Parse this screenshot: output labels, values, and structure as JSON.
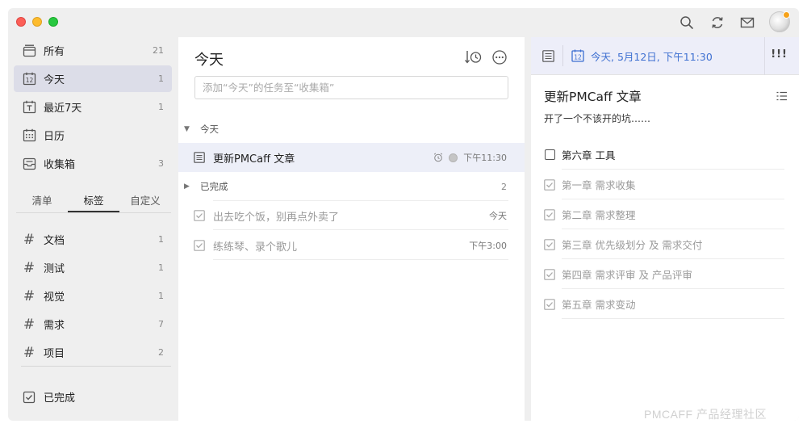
{
  "sidebar": {
    "items": [
      {
        "label": "所有",
        "count": "21",
        "icon": "inbox-tray-icon"
      },
      {
        "label": "今天",
        "count": "1",
        "icon": "calendar-day-icon",
        "icon_text": "12"
      },
      {
        "label": "最近7天",
        "count": "1",
        "icon": "calendar-week-icon"
      },
      {
        "label": "日历",
        "count": "",
        "icon": "calendar-grid-icon"
      },
      {
        "label": "收集箱",
        "count": "3",
        "icon": "inbox-icon"
      }
    ],
    "tabs": [
      "清单",
      "标签",
      "自定义"
    ],
    "tags": [
      {
        "label": "文档",
        "count": "1"
      },
      {
        "label": "测试",
        "count": "1"
      },
      {
        "label": "视觉",
        "count": "1"
      },
      {
        "label": "需求",
        "count": "7"
      },
      {
        "label": "项目",
        "count": "2"
      }
    ],
    "hash_symbol": "#",
    "completed_label": "已完成"
  },
  "list": {
    "title": "今天",
    "add_placeholder": "添加“今天”的任务至“收集箱”",
    "today_section": "今天",
    "tasks": [
      {
        "text": "更新PMCaff 文章",
        "time": "下午11:30"
      }
    ],
    "completed_section": "已完成",
    "completed_count": "2",
    "completed_tasks": [
      {
        "text": "出去吃个饭，别再点外卖了",
        "time": "今天"
      },
      {
        "text": "练练琴、录个歌儿",
        "time": "下午3:00"
      }
    ]
  },
  "detail": {
    "date_icon_text": "12",
    "date": "今天, 5月12日, 下午11:30",
    "priority": "!!!",
    "title": "更新PMCaff 文章",
    "description": "开了一个不该开的坑……",
    "subtasks": [
      {
        "text": "第六章 工具",
        "done": false
      },
      {
        "text": "第一章 需求收集",
        "done": true
      },
      {
        "text": "第二章 需求整理",
        "done": true
      },
      {
        "text": "第三章 优先级划分 及 需求交付",
        "done": true
      },
      {
        "text": "第四章 需求评审 及 产品评审",
        "done": true
      },
      {
        "text": "第五章 需求变动",
        "done": true
      }
    ]
  },
  "watermark": "PMCAFF 产品经理社区",
  "colors": {
    "accent": "#3d6fd1",
    "selected_row": "#edeff8",
    "sidebar_active": "#dcdde8"
  }
}
